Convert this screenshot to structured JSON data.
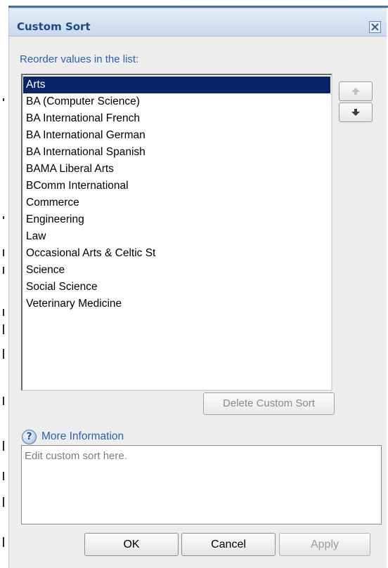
{
  "dialog": {
    "title": "Custom Sort",
    "close_icon": "close-icon"
  },
  "instruction": "Reorder values in the list:",
  "list": {
    "items": [
      "Arts",
      "BA (Computer Science)",
      "BA International French",
      "BA International German",
      "BA International Spanish",
      "BAMA Liberal Arts",
      "BComm International",
      "Commerce",
      "Engineering",
      "Law",
      "Occasional Arts & Celtic St",
      "Science",
      "Social Science",
      "Veterinary Medicine"
    ],
    "selected_index": 0
  },
  "move_buttons": {
    "up_icon": "arrow-up-icon",
    "down_icon": "arrow-down-icon"
  },
  "delete_label": "Delete Custom Sort",
  "more_info": {
    "icon": "help-icon",
    "symbol": "?",
    "label": "More Information"
  },
  "edit_box": {
    "placeholder": "Edit custom sort here."
  },
  "footer": {
    "ok_label": "OK",
    "cancel_label": "Cancel",
    "apply_label": "Apply"
  },
  "colors": {
    "title_text": "#1d4a87",
    "link_text": "#2d5fb3",
    "selection": "#0a246a"
  }
}
